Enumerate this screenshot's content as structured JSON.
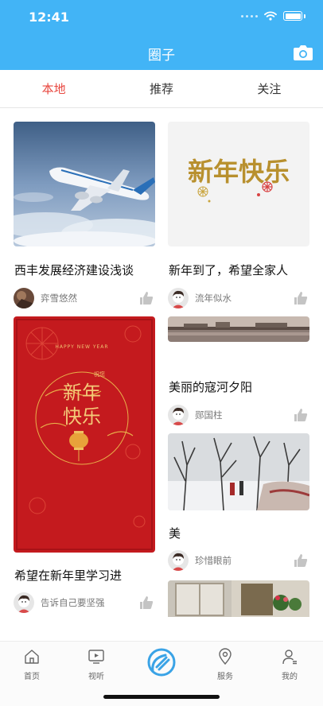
{
  "status_bar": {
    "time": "12:41"
  },
  "header": {
    "title": "圈子",
    "camera_icon": "camera-icon",
    "color": "#42b4f6"
  },
  "tabs": [
    {
      "label": "本地",
      "active": true
    },
    {
      "label": "推荐",
      "active": false
    },
    {
      "label": "关注",
      "active": false
    }
  ],
  "accent_color": "#e8473f",
  "feed": {
    "left": [
      {
        "title": "西丰发展经济建设浅谈",
        "user": "弈雪悠然",
        "image": "airplane-photo"
      },
      {
        "title": "希望在新年里学习进",
        "user": "告诉自己要坚强",
        "image": "new-year-card",
        "card_text": {
          "header": "HAPPY NEW YEAR",
          "small": "祝您",
          "line1": "新年",
          "line2": "快乐"
        }
      }
    ],
    "right": [
      {
        "title": "新年到了，希望全家人",
        "user": "流年似水",
        "image": "new-year-greeting",
        "image_text": "新年快乐"
      },
      {
        "title": "美丽的寇河夕阳",
        "user": "郧国柱",
        "image": "river-sunset-photo"
      },
      {
        "title": "美",
        "user": "珍惜眼前",
        "image": "snow-trees-photo"
      },
      {
        "title": "",
        "user": "",
        "image": "flower-window-photo"
      }
    ]
  },
  "bottom_nav": [
    {
      "label": "首页",
      "icon": "home-icon"
    },
    {
      "label": "视听",
      "icon": "tv-icon"
    },
    {
      "label": "",
      "icon": "circle-center-icon"
    },
    {
      "label": "服务",
      "icon": "location-icon"
    },
    {
      "label": "我的",
      "icon": "profile-icon"
    }
  ]
}
